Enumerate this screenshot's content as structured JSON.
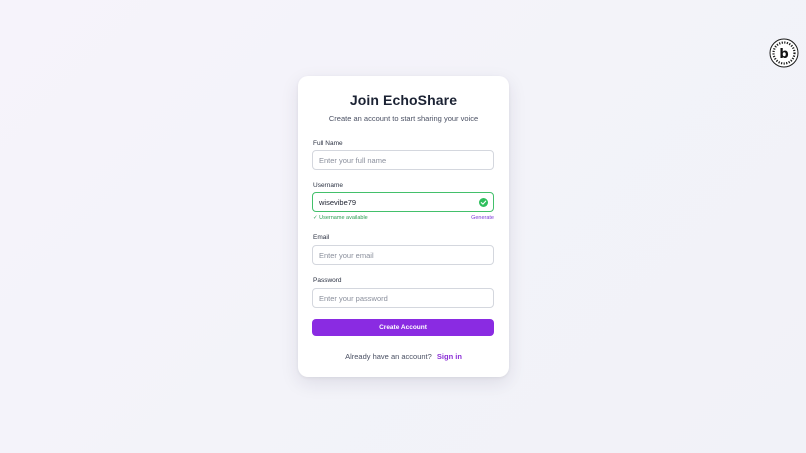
{
  "app": {
    "title": "Join EchoShare",
    "subtitle": "Create an account to start sharing your voice"
  },
  "form": {
    "full_name": {
      "label": "Full Name",
      "value": "",
      "placeholder": "Enter your full name"
    },
    "username": {
      "label": "Username",
      "value": "wisevibe79",
      "placeholder": "",
      "status_text": "✓ Username available",
      "generate_label": "Generate",
      "status_icon": "check-circle-icon"
    },
    "email": {
      "label": "Email",
      "value": "",
      "placeholder": "Enter your email"
    },
    "password": {
      "label": "Password",
      "value": "",
      "placeholder": "Enter your password"
    },
    "submit_label": "Create Account"
  },
  "footer": {
    "prompt": "Already have an account?",
    "signin_label": "Sign in"
  },
  "badge": {
    "icon": "brand-b-badge-icon",
    "letter": "b"
  },
  "colors": {
    "accent": "#8a2be2",
    "success": "#2fbf5d",
    "link": "#8b2fd6"
  }
}
